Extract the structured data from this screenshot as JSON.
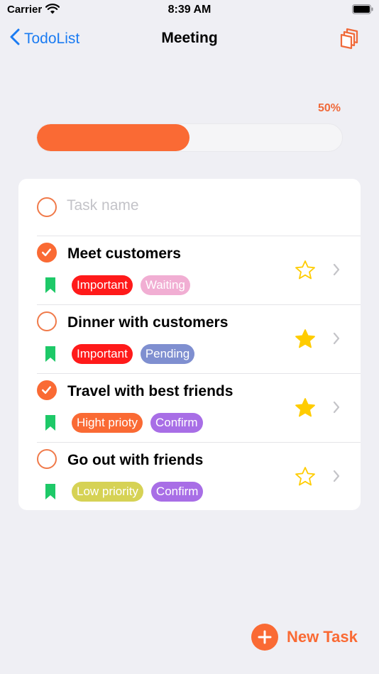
{
  "status_bar": {
    "carrier": "Carrier",
    "time": "8:39 AM"
  },
  "nav": {
    "back_label": "TodoList",
    "title": "Meeting"
  },
  "progress": {
    "label": "50%",
    "value": 0.5
  },
  "new_task_input": {
    "placeholder": "Task name"
  },
  "tasks": [
    {
      "title": "Meet customers",
      "checked": true,
      "starred": false,
      "tags": [
        {
          "label": "Important",
          "color": "#ff1a1a"
        },
        {
          "label": "Waiting",
          "color": "#f1aed3"
        }
      ]
    },
    {
      "title": "Dinner with customers",
      "checked": false,
      "starred": true,
      "tags": [
        {
          "label": "Important",
          "color": "#ff1a1a"
        },
        {
          "label": "Pending",
          "color": "#7f8fd0"
        }
      ]
    },
    {
      "title": "Travel with best friends",
      "checked": true,
      "starred": true,
      "tags": [
        {
          "label": "Hight prioty",
          "color": "#fa6a34"
        },
        {
          "label": "Confirm",
          "color": "#a86ee6"
        }
      ]
    },
    {
      "title": "Go out with friends",
      "checked": false,
      "starred": false,
      "tags": [
        {
          "label": "Low priority",
          "color": "#d6d255"
        },
        {
          "label": "Confirm",
          "color": "#a86ee6"
        }
      ]
    }
  ],
  "fab": {
    "label": "New Task"
  },
  "colors": {
    "accent": "#fa6a34",
    "link": "#1a7bf2",
    "star": "#ffcc00",
    "bookmark": "#1ec968"
  }
}
